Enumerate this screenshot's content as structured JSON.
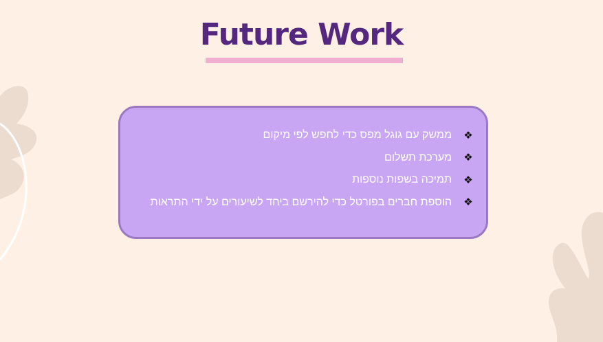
{
  "slide": {
    "title": "Future Work",
    "items": [
      {
        "bullet": "❖",
        "text": "ממשק עם גוגל מפס כדי לחפש לפי מיקום"
      },
      {
        "bullet": "❖",
        "text": "מערכת תשלום"
      },
      {
        "bullet": "❖",
        "text": "תמיכה בשפות נוספות"
      },
      {
        "bullet": "❖",
        "text": "הוספת חברים בפורטל כדי להירשם ביחד לשיעורים על ידי התראות"
      }
    ]
  },
  "colors": {
    "background": "#fff0e6",
    "title": "#55287f",
    "underline": "#f1aed0",
    "card_fill": "#c9a6f3",
    "card_border": "#9a78c2",
    "leaf": "#ecdcd0"
  }
}
